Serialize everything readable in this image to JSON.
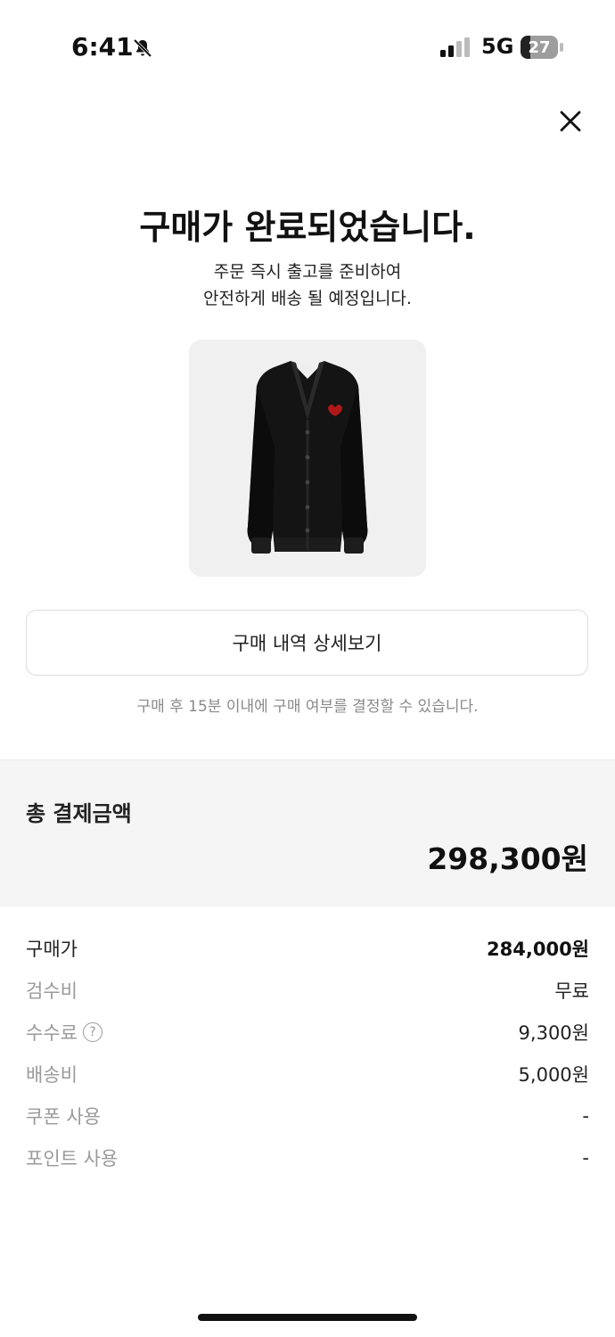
{
  "status_bar": {
    "time": "6:41",
    "network": "5G",
    "battery": "27",
    "battery_level": 0.27
  },
  "header": {
    "close_icon": "close-icon"
  },
  "completion": {
    "title": "구매가 완료되었습니다.",
    "subtitle_line1": "주문 즉시 출고를 준비하여",
    "subtitle_line2": "안전하게 배송 될 예정입니다."
  },
  "product": {
    "image": "black-cardigan"
  },
  "actions": {
    "detail_button": "구매 내역 상세보기",
    "notice": "구매 후 15분 이내에 구매 여부를 결정할 수 있습니다."
  },
  "total": {
    "label": "총 결제금액",
    "amount": "298,300원"
  },
  "breakdown": [
    {
      "label": "구매가",
      "value": "284,000원"
    },
    {
      "label": "검수비",
      "value": "무료"
    },
    {
      "label": "수수료",
      "value": "9,300원",
      "help_icon": "?"
    },
    {
      "label": "배송비",
      "value": "5,000원"
    },
    {
      "label": "쿠폰 사용",
      "value": "-"
    },
    {
      "label": "포인트 사용",
      "value": "-"
    }
  ],
  "colors": {
    "text": "#222222",
    "muted": "#9a9a9a",
    "section_bg": "#f5f5f5",
    "card_bg": "#f0f0f0"
  }
}
